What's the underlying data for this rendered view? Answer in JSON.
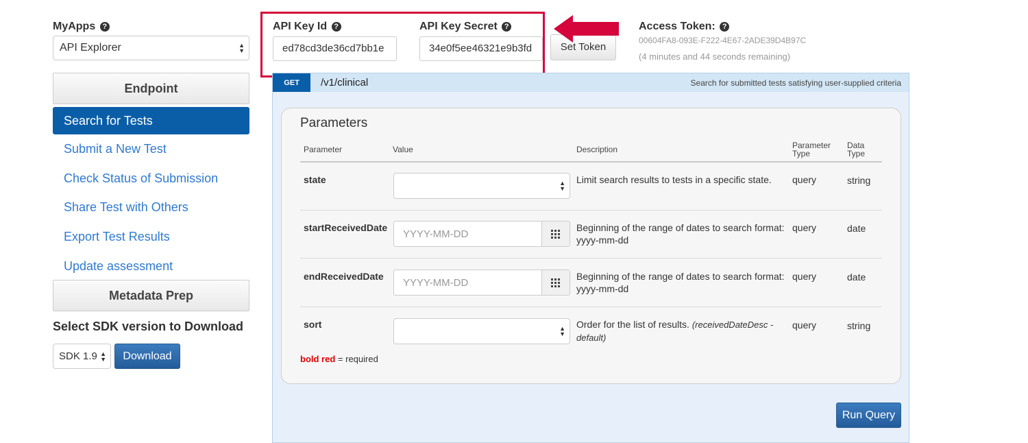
{
  "sidebar": {
    "myapps_label": "MyApps",
    "myapps_value": "API Explorer",
    "endpoint_header": "Endpoint",
    "items": [
      {
        "label": "Search for Tests",
        "active": true
      },
      {
        "label": "Submit a New Test"
      },
      {
        "label": "Check Status of Submission"
      },
      {
        "label": "Share Test with Others"
      },
      {
        "label": "Export Test Results"
      },
      {
        "label": "Update assessment"
      }
    ],
    "metadata_header": "Metadata Prep",
    "sdk_title": "Select SDK version to Download",
    "sdk_value": "SDK 1.9",
    "download_label": "Download"
  },
  "keys": {
    "api_key_id_label": "API Key Id",
    "api_key_id_value": "ed78cd3de36cd7bb1e",
    "api_key_secret_label": "API Key Secret",
    "api_key_secret_value": "34e0f5ee46321e9b3fd",
    "set_token_label": "Set Token"
  },
  "token": {
    "label": "Access Token:",
    "value": "00604FA8-093E-F222-4E67-2ADE39D4B97C",
    "remaining": "(4 minutes and 44 seconds remaining)"
  },
  "endpoint": {
    "method": "GET",
    "path": "/v1/clinical",
    "summary": "Search for submitted tests satisfying user-supplied criteria"
  },
  "parameters": {
    "title": "Parameters",
    "headers": {
      "parameter": "Parameter",
      "value": "Value",
      "description": "Description",
      "param_type_1": "Parameter",
      "param_type_2": "Type",
      "data_type_1": "Data",
      "data_type_2": "Type"
    },
    "rows": [
      {
        "name": "state",
        "value": "",
        "description": "Limit search results to tests in a specific state.",
        "description_2": "",
        "ptype": "query",
        "dtype": "string"
      },
      {
        "name": "startReceivedDate",
        "placeholder": "YYYY-MM-DD",
        "description": "Beginning of the range of dates to search format:",
        "description_2": "yyyy-mm-dd",
        "ptype": "query",
        "dtype": "date"
      },
      {
        "name": "endReceivedDate",
        "placeholder": "YYYY-MM-DD",
        "description": "Beginning of the range of dates to search format:",
        "description_2": "yyyy-mm-dd",
        "ptype": "query",
        "dtype": "date"
      },
      {
        "name": "sort",
        "value": "",
        "description": "Order for the list of results.",
        "description_italic": "(receivedDateDesc -",
        "description_2": "default)",
        "ptype": "query",
        "dtype": "string"
      }
    ],
    "legend_bold": "bold red",
    "legend_rest": "= required"
  },
  "run_query_label": "Run Query",
  "colors": {
    "highlight_box": "#d4063b",
    "arrow": "#d4063b",
    "active_nav": "#0a5ea8",
    "link": "#2f7ad1",
    "required": "#e00000"
  }
}
